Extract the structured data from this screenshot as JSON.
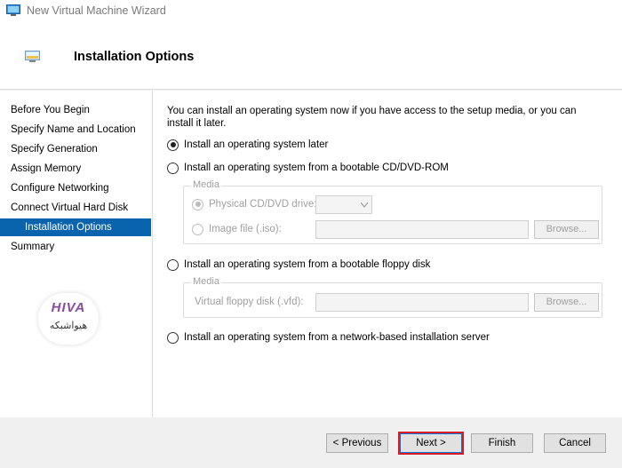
{
  "window": {
    "title": "New Virtual Machine Wizard"
  },
  "header": {
    "title": "Installation Options"
  },
  "sidebar": {
    "items": [
      {
        "label": "Before You Begin"
      },
      {
        "label": "Specify Name and Location"
      },
      {
        "label": "Specify Generation"
      },
      {
        "label": "Assign Memory"
      },
      {
        "label": "Configure Networking"
      },
      {
        "label": "Connect Virtual Hard Disk"
      },
      {
        "label": "Installation Options",
        "active": true
      },
      {
        "label": "Summary"
      }
    ]
  },
  "watermark": {
    "logo": "HIVA",
    "text": "هیواشبکه"
  },
  "main": {
    "intro": "You can install an operating system now if you have access to the setup media, or you can install it later.",
    "options": {
      "later": {
        "label": "Install an operating system later",
        "selected": true
      },
      "cd": {
        "label": "Install an operating system from a bootable CD/DVD-ROM",
        "selected": false
      },
      "floppy": {
        "label": "Install an operating system from a bootable floppy disk",
        "selected": false
      },
      "network": {
        "label": "Install an operating system from a network-based installation server",
        "selected": false
      }
    },
    "cd_media": {
      "legend": "Media",
      "physical_label": "Physical CD/DVD drive:",
      "physical_value": "",
      "image_label": "Image file (.iso):",
      "image_value": "",
      "browse": "Browse..."
    },
    "floppy_media": {
      "legend": "Media",
      "vfd_label": "Virtual floppy disk (.vfd):",
      "vfd_value": "",
      "browse": "Browse..."
    }
  },
  "footer": {
    "previous": "< Previous",
    "next": "Next >",
    "finish": "Finish",
    "cancel": "Cancel"
  },
  "colors": {
    "accent": "#0a64ad",
    "highlight": "#d91c23"
  },
  "icons": {
    "app": "hyper-v-monitor-icon",
    "header": "monitor-icon"
  }
}
